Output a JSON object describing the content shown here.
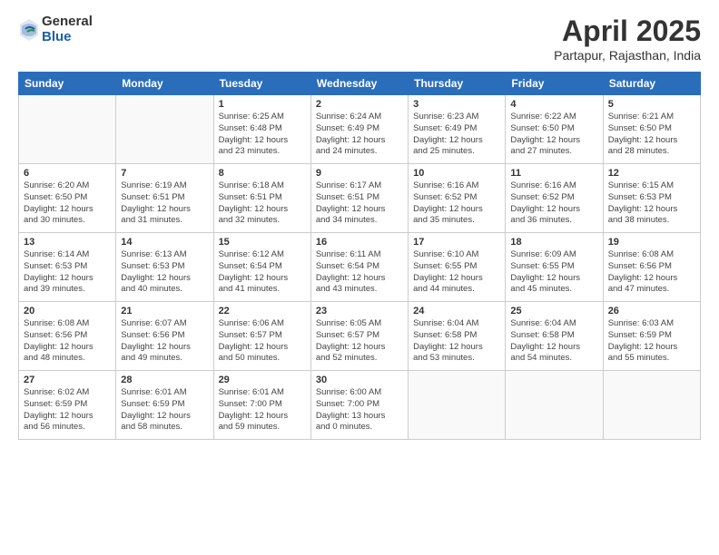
{
  "logo": {
    "general": "General",
    "blue": "Blue"
  },
  "title": "April 2025",
  "subtitle": "Partapur, Rajasthan, India",
  "headers": [
    "Sunday",
    "Monday",
    "Tuesday",
    "Wednesday",
    "Thursday",
    "Friday",
    "Saturday"
  ],
  "weeks": [
    [
      {
        "day": "",
        "info": ""
      },
      {
        "day": "",
        "info": ""
      },
      {
        "day": "1",
        "info": "Sunrise: 6:25 AM\nSunset: 6:48 PM\nDaylight: 12 hours\nand 23 minutes."
      },
      {
        "day": "2",
        "info": "Sunrise: 6:24 AM\nSunset: 6:49 PM\nDaylight: 12 hours\nand 24 minutes."
      },
      {
        "day": "3",
        "info": "Sunrise: 6:23 AM\nSunset: 6:49 PM\nDaylight: 12 hours\nand 25 minutes."
      },
      {
        "day": "4",
        "info": "Sunrise: 6:22 AM\nSunset: 6:50 PM\nDaylight: 12 hours\nand 27 minutes."
      },
      {
        "day": "5",
        "info": "Sunrise: 6:21 AM\nSunset: 6:50 PM\nDaylight: 12 hours\nand 28 minutes."
      }
    ],
    [
      {
        "day": "6",
        "info": "Sunrise: 6:20 AM\nSunset: 6:50 PM\nDaylight: 12 hours\nand 30 minutes."
      },
      {
        "day": "7",
        "info": "Sunrise: 6:19 AM\nSunset: 6:51 PM\nDaylight: 12 hours\nand 31 minutes."
      },
      {
        "day": "8",
        "info": "Sunrise: 6:18 AM\nSunset: 6:51 PM\nDaylight: 12 hours\nand 32 minutes."
      },
      {
        "day": "9",
        "info": "Sunrise: 6:17 AM\nSunset: 6:51 PM\nDaylight: 12 hours\nand 34 minutes."
      },
      {
        "day": "10",
        "info": "Sunrise: 6:16 AM\nSunset: 6:52 PM\nDaylight: 12 hours\nand 35 minutes."
      },
      {
        "day": "11",
        "info": "Sunrise: 6:16 AM\nSunset: 6:52 PM\nDaylight: 12 hours\nand 36 minutes."
      },
      {
        "day": "12",
        "info": "Sunrise: 6:15 AM\nSunset: 6:53 PM\nDaylight: 12 hours\nand 38 minutes."
      }
    ],
    [
      {
        "day": "13",
        "info": "Sunrise: 6:14 AM\nSunset: 6:53 PM\nDaylight: 12 hours\nand 39 minutes."
      },
      {
        "day": "14",
        "info": "Sunrise: 6:13 AM\nSunset: 6:53 PM\nDaylight: 12 hours\nand 40 minutes."
      },
      {
        "day": "15",
        "info": "Sunrise: 6:12 AM\nSunset: 6:54 PM\nDaylight: 12 hours\nand 41 minutes."
      },
      {
        "day": "16",
        "info": "Sunrise: 6:11 AM\nSunset: 6:54 PM\nDaylight: 12 hours\nand 43 minutes."
      },
      {
        "day": "17",
        "info": "Sunrise: 6:10 AM\nSunset: 6:55 PM\nDaylight: 12 hours\nand 44 minutes."
      },
      {
        "day": "18",
        "info": "Sunrise: 6:09 AM\nSunset: 6:55 PM\nDaylight: 12 hours\nand 45 minutes."
      },
      {
        "day": "19",
        "info": "Sunrise: 6:08 AM\nSunset: 6:56 PM\nDaylight: 12 hours\nand 47 minutes."
      }
    ],
    [
      {
        "day": "20",
        "info": "Sunrise: 6:08 AM\nSunset: 6:56 PM\nDaylight: 12 hours\nand 48 minutes."
      },
      {
        "day": "21",
        "info": "Sunrise: 6:07 AM\nSunset: 6:56 PM\nDaylight: 12 hours\nand 49 minutes."
      },
      {
        "day": "22",
        "info": "Sunrise: 6:06 AM\nSunset: 6:57 PM\nDaylight: 12 hours\nand 50 minutes."
      },
      {
        "day": "23",
        "info": "Sunrise: 6:05 AM\nSunset: 6:57 PM\nDaylight: 12 hours\nand 52 minutes."
      },
      {
        "day": "24",
        "info": "Sunrise: 6:04 AM\nSunset: 6:58 PM\nDaylight: 12 hours\nand 53 minutes."
      },
      {
        "day": "25",
        "info": "Sunrise: 6:04 AM\nSunset: 6:58 PM\nDaylight: 12 hours\nand 54 minutes."
      },
      {
        "day": "26",
        "info": "Sunrise: 6:03 AM\nSunset: 6:59 PM\nDaylight: 12 hours\nand 55 minutes."
      }
    ],
    [
      {
        "day": "27",
        "info": "Sunrise: 6:02 AM\nSunset: 6:59 PM\nDaylight: 12 hours\nand 56 minutes."
      },
      {
        "day": "28",
        "info": "Sunrise: 6:01 AM\nSunset: 6:59 PM\nDaylight: 12 hours\nand 58 minutes."
      },
      {
        "day": "29",
        "info": "Sunrise: 6:01 AM\nSunset: 7:00 PM\nDaylight: 12 hours\nand 59 minutes."
      },
      {
        "day": "30",
        "info": "Sunrise: 6:00 AM\nSunset: 7:00 PM\nDaylight: 13 hours\nand 0 minutes."
      },
      {
        "day": "",
        "info": ""
      },
      {
        "day": "",
        "info": ""
      },
      {
        "day": "",
        "info": ""
      }
    ]
  ]
}
